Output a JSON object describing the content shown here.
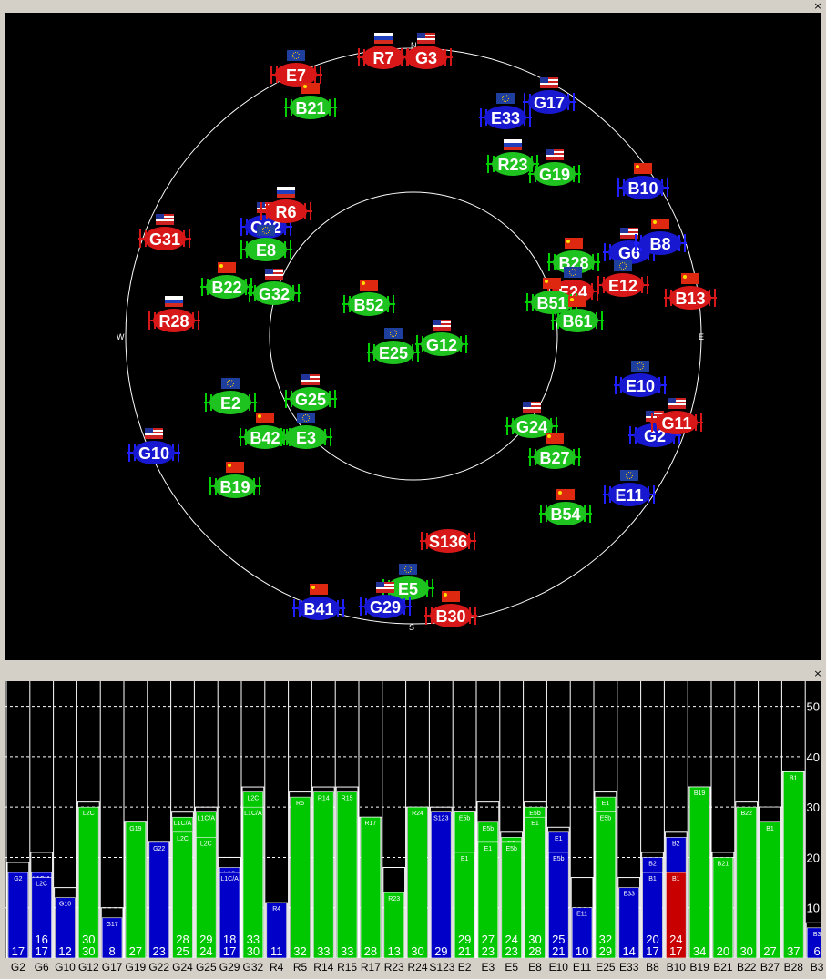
{
  "skyplot": {
    "close_label": "×",
    "compass": {
      "n": "N",
      "s": "S",
      "e": "E",
      "w": "W"
    },
    "satellites": [
      {
        "id": "E7",
        "c": "red",
        "flag": "eu"
      },
      {
        "id": "R7",
        "c": "red",
        "flag": "ru"
      },
      {
        "id": "G3",
        "c": "red",
        "flag": "us"
      },
      {
        "id": "B21",
        "c": "green",
        "flag": "cn"
      },
      {
        "id": "E33",
        "c": "blue",
        "flag": "eu"
      },
      {
        "id": "G17",
        "c": "blue",
        "flag": "us"
      },
      {
        "id": "R23",
        "c": "green",
        "flag": "ru"
      },
      {
        "id": "G19",
        "c": "green",
        "flag": "us"
      },
      {
        "id": "B10",
        "c": "blue",
        "flag": "cn"
      },
      {
        "id": "G22",
        "c": "blue",
        "flag": "us"
      },
      {
        "id": "R6",
        "c": "red",
        "flag": "ru"
      },
      {
        "id": "G31",
        "c": "red",
        "flag": "us"
      },
      {
        "id": "E8",
        "c": "green",
        "flag": "eu"
      },
      {
        "id": "G6",
        "c": "blue",
        "flag": "us"
      },
      {
        "id": "B8",
        "c": "blue",
        "flag": "cn"
      },
      {
        "id": "B28",
        "c": "green",
        "flag": "cn"
      },
      {
        "id": "E12",
        "c": "red",
        "flag": "eu"
      },
      {
        "id": "B13",
        "c": "red",
        "flag": "cn"
      },
      {
        "id": "B22",
        "c": "green",
        "flag": "cn"
      },
      {
        "id": "G32",
        "c": "green",
        "flag": "us"
      },
      {
        "id": "B52",
        "c": "green",
        "flag": "cn"
      },
      {
        "id": "E24",
        "c": "red",
        "flag": "eu"
      },
      {
        "id": "B51",
        "c": "green",
        "flag": "cn"
      },
      {
        "id": "B61",
        "c": "green",
        "flag": "cn"
      },
      {
        "id": "R28",
        "c": "red",
        "flag": "ru"
      },
      {
        "id": "E25",
        "c": "green",
        "flag": "eu"
      },
      {
        "id": "G12",
        "c": "green",
        "flag": "us"
      },
      {
        "id": "E10",
        "c": "blue",
        "flag": "eu"
      },
      {
        "id": "E2",
        "c": "green",
        "flag": "eu"
      },
      {
        "id": "G25",
        "c": "green",
        "flag": "us"
      },
      {
        "id": "G24",
        "c": "green",
        "flag": "us"
      },
      {
        "id": "G2",
        "c": "blue",
        "flag": "us"
      },
      {
        "id": "G11",
        "c": "red",
        "flag": "us"
      },
      {
        "id": "B42",
        "c": "green",
        "flag": "cn"
      },
      {
        "id": "E3",
        "c": "green",
        "flag": "eu"
      },
      {
        "id": "G10",
        "c": "blue",
        "flag": "us"
      },
      {
        "id": "B27",
        "c": "green",
        "flag": "cn"
      },
      {
        "id": "B19",
        "c": "green",
        "flag": "cn"
      },
      {
        "id": "E11",
        "c": "blue",
        "flag": "eu"
      },
      {
        "id": "B54",
        "c": "green",
        "flag": "cn"
      },
      {
        "id": "S136",
        "c": "red",
        "flag": ""
      },
      {
        "id": "E5",
        "c": "green",
        "flag": "eu"
      },
      {
        "id": "B41",
        "c": "blue",
        "flag": "cn"
      },
      {
        "id": "G29",
        "c": "blue",
        "flag": "us"
      },
      {
        "id": "B30",
        "c": "red",
        "flag": "cn"
      }
    ]
  },
  "snr_chart": {
    "close_label": "×",
    "y_ticks": [
      "10",
      "20",
      "30",
      "40",
      "50"
    ],
    "ymax": 55,
    "colors": {
      "green": "#00c800",
      "blue": "#0000c8",
      "red": "#c80000",
      "black": "#000000"
    },
    "columns": [
      {
        "label": "G2",
        "max": 19,
        "v": [
          17
        ],
        "bands": [
          {
            "v": 17,
            "c": "blue",
            "t": "G2"
          }
        ]
      },
      {
        "label": "G6",
        "max": 21,
        "v": [
          16,
          17
        ],
        "bands": [
          {
            "v": 17,
            "c": "blue",
            "t": "L1C/A"
          },
          {
            "v": 16,
            "c": "blue",
            "t": "L2C"
          }
        ]
      },
      {
        "label": "G10",
        "max": 14,
        "v": [
          12
        ],
        "bands": [
          {
            "v": 12,
            "c": "blue",
            "t": "G10"
          }
        ]
      },
      {
        "label": "G12",
        "max": 31,
        "v": [
          30,
          30
        ],
        "bands": [
          {
            "v": 30,
            "c": "green",
            "t": "L2C"
          }
        ]
      },
      {
        "label": "G17",
        "max": 10,
        "v": [
          8
        ],
        "bands": [
          {
            "v": 8,
            "c": "blue",
            "t": "G17"
          }
        ]
      },
      {
        "label": "G19",
        "max": 27,
        "v": [
          27
        ],
        "bands": [
          {
            "v": 27,
            "c": "green",
            "t": "G19"
          }
        ]
      },
      {
        "label": "G22",
        "max": 23,
        "v": [
          23
        ],
        "bands": [
          {
            "v": 23,
            "c": "blue",
            "t": "G22"
          }
        ]
      },
      {
        "label": "G24",
        "max": 29,
        "v": [
          28,
          25
        ],
        "bands": [
          {
            "v": 28,
            "c": "green",
            "t": "L1C/A"
          },
          {
            "v": 25,
            "c": "green",
            "t": "L2C"
          }
        ]
      },
      {
        "label": "G25",
        "max": 30,
        "v": [
          29,
          24
        ],
        "bands": [
          {
            "v": 29,
            "c": "green",
            "t": "L1C/A"
          },
          {
            "v": 24,
            "c": "green",
            "t": "L2C"
          }
        ]
      },
      {
        "label": "G29",
        "max": 20,
        "v": [
          18,
          17
        ],
        "bands": [
          {
            "v": 18,
            "c": "blue",
            "t": "L2C"
          },
          {
            "v": 17,
            "c": "blue",
            "t": "L1C/A"
          }
        ]
      },
      {
        "label": "G32",
        "max": 34,
        "v": [
          33,
          30
        ],
        "bands": [
          {
            "v": 33,
            "c": "green",
            "t": "L2C"
          },
          {
            "v": 30,
            "c": "green",
            "t": "L1C/A"
          }
        ]
      },
      {
        "label": "R4",
        "max": 11,
        "v": [
          11
        ],
        "bands": [
          {
            "v": 11,
            "c": "blue",
            "t": "R4"
          }
        ]
      },
      {
        "label": "R5",
        "max": 33,
        "v": [
          32
        ],
        "bands": [
          {
            "v": 32,
            "c": "green",
            "t": "R5"
          }
        ]
      },
      {
        "label": "R14",
        "max": 34,
        "v": [
          33
        ],
        "bands": [
          {
            "v": 33,
            "c": "green",
            "t": "R14"
          }
        ]
      },
      {
        "label": "R15",
        "max": 34,
        "v": [
          33
        ],
        "bands": [
          {
            "v": 33,
            "c": "green",
            "t": "R15"
          }
        ]
      },
      {
        "label": "R17",
        "max": 28,
        "v": [
          28
        ],
        "bands": [
          {
            "v": 28,
            "c": "green",
            "t": "R17"
          }
        ]
      },
      {
        "label": "R23",
        "max": 18,
        "v": [
          13
        ],
        "bands": [
          {
            "v": 13,
            "c": "green",
            "t": "R23"
          }
        ]
      },
      {
        "label": "R24",
        "max": 30,
        "v": [
          30
        ],
        "bands": [
          {
            "v": 30,
            "c": "green",
            "t": "R24"
          }
        ]
      },
      {
        "label": "S123",
        "max": 30,
        "v": [
          29
        ],
        "bands": [
          {
            "v": 29,
            "c": "blue",
            "t": "S123"
          }
        ]
      },
      {
        "label": "E2",
        "max": 29,
        "v": [
          29,
          21
        ],
        "bands": [
          {
            "v": 29,
            "c": "green",
            "t": "E5b"
          },
          {
            "v": 21,
            "c": "green",
            "t": "E1"
          }
        ]
      },
      {
        "label": "E3",
        "max": 31,
        "v": [
          27,
          23
        ],
        "bands": [
          {
            "v": 27,
            "c": "green",
            "t": "E5b"
          },
          {
            "v": 23,
            "c": "green",
            "t": "E1"
          }
        ]
      },
      {
        "label": "E5",
        "max": 25,
        "v": [
          24,
          23
        ],
        "bands": [
          {
            "v": 24,
            "c": "green",
            "t": "E1"
          },
          {
            "v": 23,
            "c": "green",
            "t": "E5b"
          }
        ]
      },
      {
        "label": "E8",
        "max": 31,
        "v": [
          30,
          28
        ],
        "bands": [
          {
            "v": 30,
            "c": "green",
            "t": "E5b"
          },
          {
            "v": 28,
            "c": "green",
            "t": "E1"
          }
        ]
      },
      {
        "label": "E10",
        "max": 26,
        "v": [
          25,
          21
        ],
        "bands": [
          {
            "v": 25,
            "c": "blue",
            "t": "E1"
          },
          {
            "v": 21,
            "c": "blue",
            "t": "E5b"
          }
        ]
      },
      {
        "label": "E11",
        "max": 16,
        "v": [
          10
        ],
        "bands": [
          {
            "v": 10,
            "c": "blue",
            "t": "E11"
          }
        ]
      },
      {
        "label": "E25",
        "max": 33,
        "v": [
          32,
          29
        ],
        "bands": [
          {
            "v": 32,
            "c": "green",
            "t": "E1"
          },
          {
            "v": 29,
            "c": "green",
            "t": "E5b"
          }
        ]
      },
      {
        "label": "E33",
        "max": 16,
        "v": [
          14
        ],
        "bands": [
          {
            "v": 14,
            "c": "blue",
            "t": "E33"
          }
        ]
      },
      {
        "label": "B8",
        "max": 21,
        "v": [
          20,
          17
        ],
        "bands": [
          {
            "v": 20,
            "c": "blue",
            "t": "B2"
          },
          {
            "v": 17,
            "c": "blue",
            "t": "B1"
          }
        ]
      },
      {
        "label": "B10",
        "max": 25,
        "v": [
          24,
          17
        ],
        "bands": [
          {
            "v": 24,
            "c": "blue",
            "t": "B2"
          },
          {
            "v": 17,
            "c": "red",
            "t": "B1"
          }
        ]
      },
      {
        "label": "B19",
        "max": 34,
        "v": [
          34
        ],
        "bands": [
          {
            "v": 34,
            "c": "green",
            "t": "B19"
          }
        ]
      },
      {
        "label": "B21",
        "max": 21,
        "v": [
          20
        ],
        "bands": [
          {
            "v": 20,
            "c": "green",
            "t": "B21"
          }
        ]
      },
      {
        "label": "B22",
        "max": 31,
        "v": [
          30
        ],
        "bands": [
          {
            "v": 30,
            "c": "green",
            "t": "B22"
          }
        ]
      },
      {
        "label": "B27",
        "max": 30,
        "v": [
          27
        ],
        "bands": [
          {
            "v": 30,
            "c": "black",
            "t": ""
          },
          {
            "v": 27,
            "c": "green",
            "t": "B1"
          }
        ]
      },
      {
        "label": "B28",
        "max": 37,
        "v": [
          37
        ],
        "bands": [
          {
            "v": 37,
            "c": "green",
            "t": "B1"
          }
        ]
      },
      {
        "label": "B3",
        "max": 7,
        "v": [
          6
        ],
        "bands": [
          {
            "v": 6,
            "c": "blue",
            "t": "B3"
          }
        ]
      }
    ]
  }
}
